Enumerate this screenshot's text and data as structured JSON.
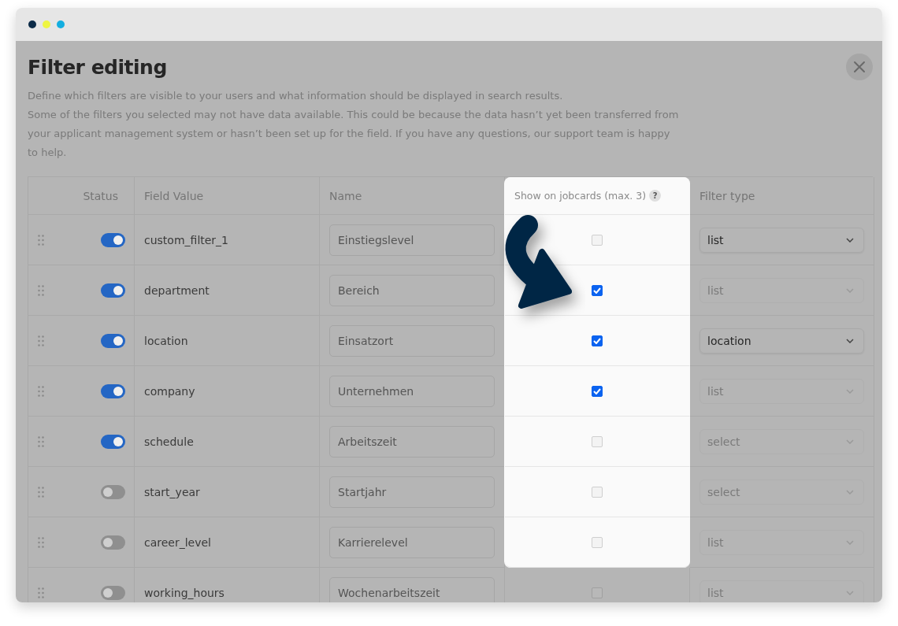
{
  "window": {
    "dots": [
      {
        "color": "#0b2a47"
      },
      {
        "color": "#eef542"
      },
      {
        "color": "#13aee0"
      }
    ]
  },
  "title": "Filter editing",
  "intro": "Define which filters are visible to your users and what information should be displayed in search results.",
  "notice": "Some of the filters you selected may not have data available. This could be because the data hasn’t yet been transferred from your applicant management system or hasn’t been set up for the field. If you have any questions, our support team is happy to help.",
  "table": {
    "columns": [
      {
        "label": "Status"
      },
      {
        "label": "Field Value"
      },
      {
        "label": "Name"
      },
      {
        "label": "Show on jobcards (max. 3)",
        "help": "?",
        "spotlight": true
      },
      {
        "label": "Filter type"
      }
    ],
    "rows": [
      {
        "on": true,
        "field": "custom_filter_1",
        "name": "Einstiegslevel",
        "jobcard": false,
        "spotlight": true,
        "type": "list",
        "type_disabled": false
      },
      {
        "on": true,
        "field": "department",
        "name": "Bereich",
        "jobcard": true,
        "spotlight": true,
        "type": "list",
        "type_disabled": true
      },
      {
        "on": true,
        "field": "location",
        "name": "Einsatzort",
        "jobcard": true,
        "spotlight": true,
        "type": "location",
        "type_disabled": false
      },
      {
        "on": true,
        "field": "company",
        "name": "Unternehmen",
        "jobcard": true,
        "spotlight": true,
        "type": "list",
        "type_disabled": true
      },
      {
        "on": true,
        "field": "schedule",
        "name": "Arbeitszeit",
        "jobcard": false,
        "spotlight": true,
        "type": "select",
        "type_disabled": true
      },
      {
        "on": false,
        "field": "start_year",
        "name": "Startjahr",
        "jobcard": false,
        "spotlight": true,
        "type": "select",
        "type_disabled": true
      },
      {
        "on": false,
        "field": "career_level",
        "name": "Karrierelevel",
        "jobcard": false,
        "spotlight": true,
        "type": "list",
        "type_disabled": true
      },
      {
        "on": false,
        "field": "working_hours",
        "name": "Wochenarbeitszeit",
        "jobcard": false,
        "spotlight": false,
        "type": "list",
        "type_disabled": true
      }
    ]
  }
}
